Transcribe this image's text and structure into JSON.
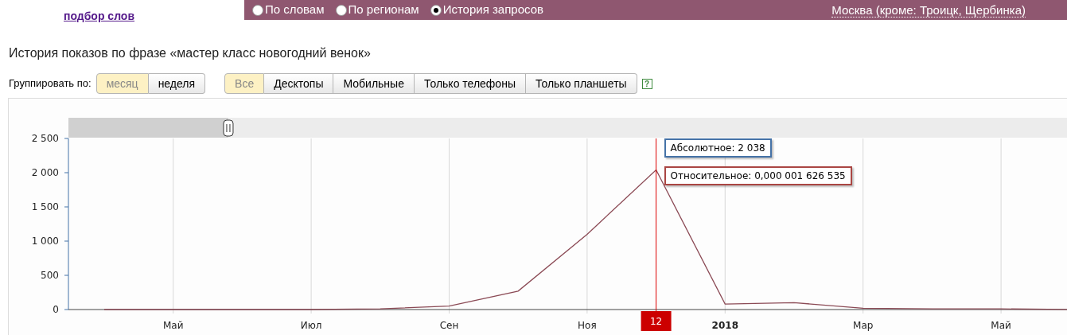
{
  "top_link": "подбор слов",
  "modes": [
    {
      "label": "По словам",
      "selected": false
    },
    {
      "label": "По регионам",
      "selected": false
    },
    {
      "label": "История запросов",
      "selected": true
    }
  ],
  "region": "Москва (кроме: Троицк, Щербинка)",
  "heading": "История показов по фразе «мастер класс новогодний венок»",
  "group_label": "Группировать по:",
  "group_options": [
    {
      "label": "месяц",
      "selected": true
    },
    {
      "label": "неделя",
      "selected": false
    }
  ],
  "device_options": [
    {
      "label": "Все",
      "selected": true
    },
    {
      "label": "Десктопы",
      "selected": false
    },
    {
      "label": "Мобильные",
      "selected": false
    },
    {
      "label": "Только телефоны",
      "selected": false
    },
    {
      "label": "Только планшеты",
      "selected": false
    }
  ],
  "help": "?",
  "navigator": {
    "level": 0.16
  },
  "chart": {
    "chart_data": {
      "type": "line",
      "grid": true,
      "categories": [
        null,
        "Май",
        null,
        "Июл",
        null,
        "Сен",
        null,
        "Ноя",
        null,
        "2018",
        null,
        "Мар",
        null,
        "Май",
        null
      ],
      "series": [
        {
          "color": "#8b4a55",
          "values": [
            0,
            0,
            0,
            0,
            10,
            50,
            270,
            1100,
            2040,
            80,
            100,
            20,
            10,
            10,
            0
          ]
        }
      ],
      "ylim": [
        0,
        2500
      ],
      "yticks": [
        {
          "value": 0,
          "label": "0"
        },
        {
          "value": 500,
          "label": "500"
        },
        {
          "value": 1000,
          "label": "1 000"
        },
        {
          "value": 1500,
          "label": "1 500"
        },
        {
          "value": 2000,
          "label": "2 000"
        },
        {
          "value": 2500,
          "label": "2 500"
        }
      ],
      "annotations": [
        "12"
      ]
    },
    "tooltips": [
      {
        "text": "Абсолютное: 2 038",
        "color": "#4572a7"
      },
      {
        "text": "Относительное: 0,000 001 626 535",
        "color": "#aa4643"
      }
    ]
  }
}
